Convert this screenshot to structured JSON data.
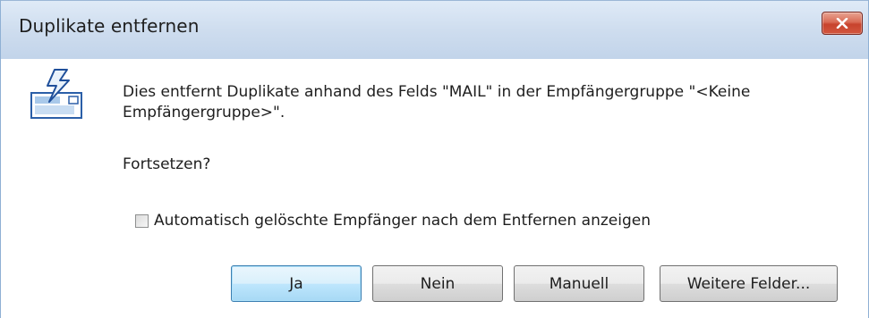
{
  "window": {
    "title": "Duplikate entfernen"
  },
  "dialog": {
    "message": "Dies entfernt Duplikate anhand des Felds \"MAIL\" in der Empfängergruppe \"<Keine Empfängergruppe>\".",
    "question": "Fortsetzen?",
    "checkbox": {
      "label": "Automatisch gelöschte Empfänger nach dem Entfernen anzeigen",
      "checked": false
    }
  },
  "buttons": {
    "yes_label": "Ja",
    "no_label": "Nein",
    "manual_label": "Manuell",
    "more_fields_label": "Weitere Felder..."
  },
  "icons": {
    "app_icon": "mail-lightning-icon",
    "close_icon": "close-icon"
  },
  "colors": {
    "titlebar": "#cddcee",
    "close_button": "#c8432d",
    "default_button_border": "#3c7fb1"
  }
}
